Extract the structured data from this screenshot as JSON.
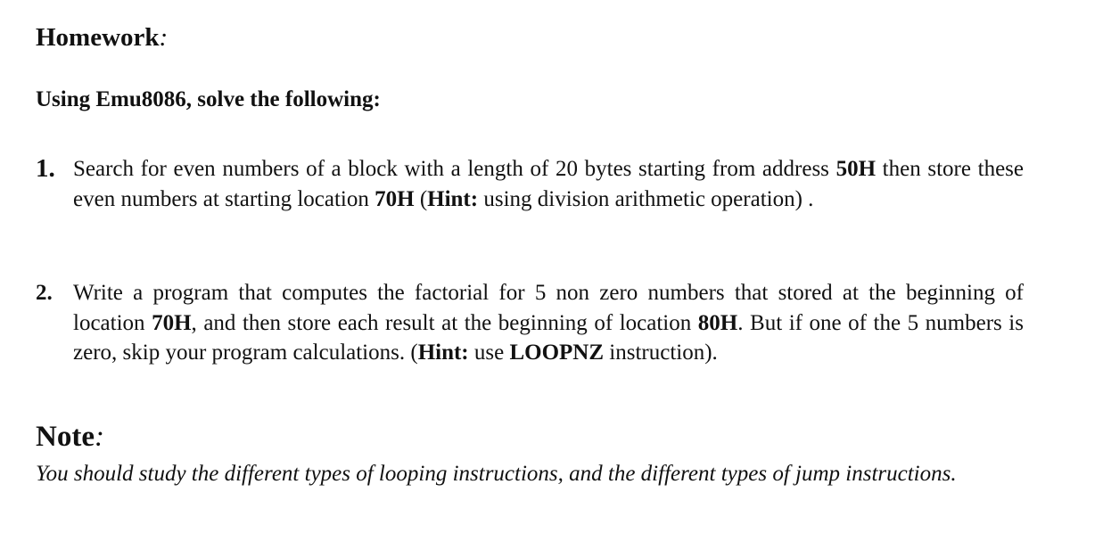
{
  "heading": {
    "title": "Homework",
    "colon": ":"
  },
  "subtitle": "Using Emu8086, solve the following:",
  "items": [
    {
      "number": "1.",
      "parts": [
        "Search for even numbers of a block with a length of 20 bytes starting from address ",
        "50H",
        " then store these even numbers at starting location ",
        "70H",
        " (",
        "Hint:",
        " using division arithmetic operation) ."
      ]
    },
    {
      "number": "2.",
      "parts": [
        "Write a program that computes the factorial for 5 non zero numbers that stored at the beginning of location ",
        "70H",
        ", and then store each result at the beginning of location ",
        "80H",
        ". But if one of the 5 numbers is zero, skip your program calculations. (",
        "Hint:",
        " use ",
        "LOOPNZ",
        " instruction)."
      ]
    }
  ],
  "note": {
    "title": "Note",
    "colon": ":",
    "body": " You should study the different types of looping instructions, and the different types of jump instructions."
  }
}
